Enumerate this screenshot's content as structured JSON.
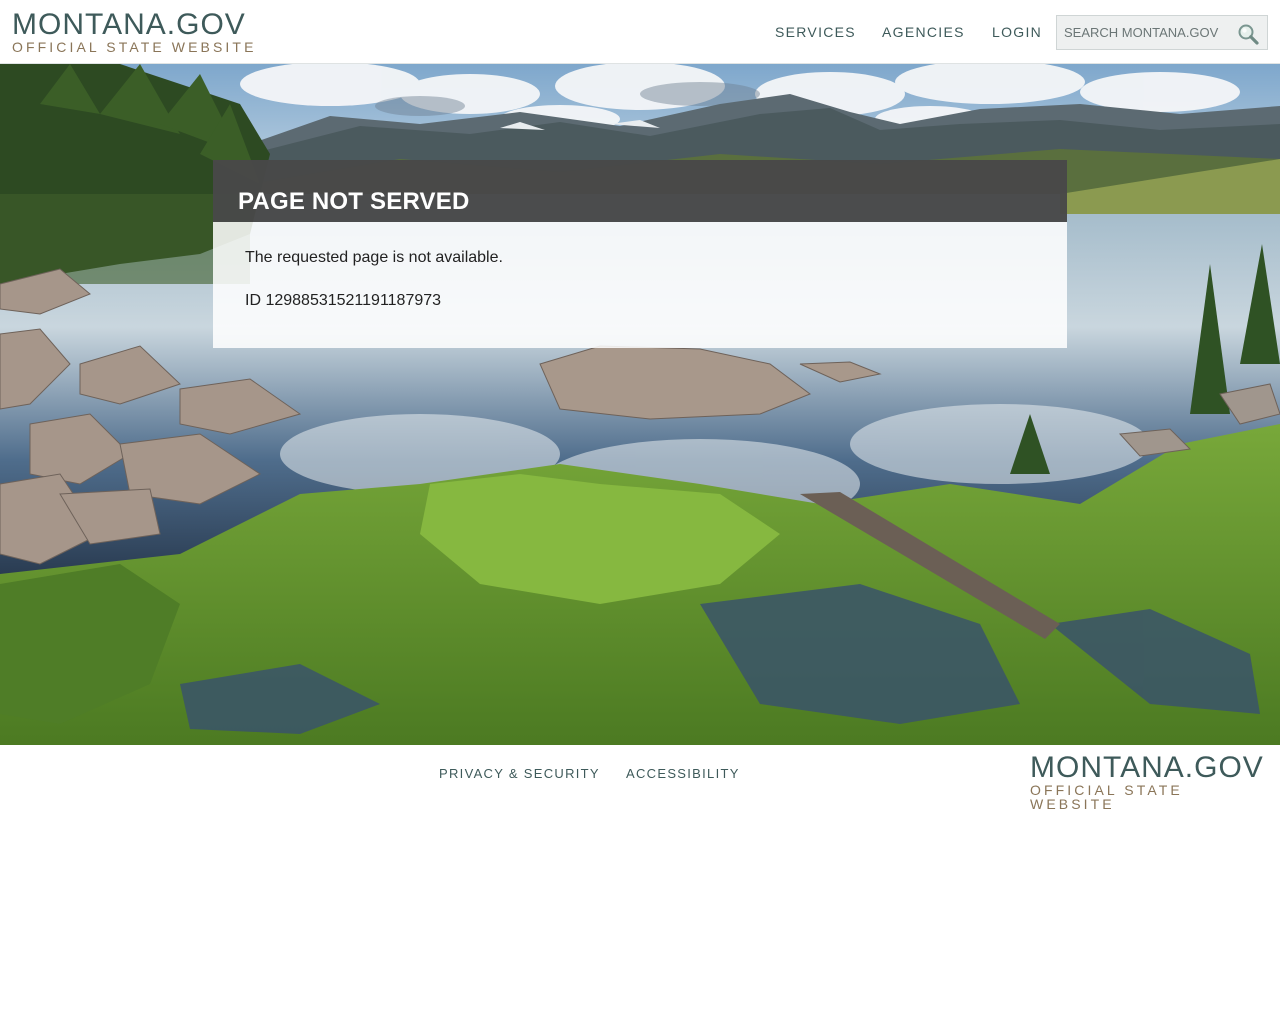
{
  "header": {
    "logo_main": "MONTANA.GOV",
    "logo_sub": "OFFICIAL STATE WEBSITE",
    "nav": {
      "services": "SERVICES",
      "agencies": "AGENCIES",
      "login": "LOGIN"
    },
    "search": {
      "placeholder": "SEARCH MONTANA.GOV",
      "icon": "search-icon"
    }
  },
  "hero": {
    "image": "mountain-lake-landscape"
  },
  "error": {
    "title": "PAGE NOT SERVED",
    "message": "The requested page is not available.",
    "id": "ID 12988531521191187973"
  },
  "footer": {
    "links": {
      "privacy": "PRIVACY & SECURITY",
      "accessibility": "ACCESSIBILITY"
    },
    "logo_main": "MONTANA.GOV",
    "logo_sub": "OFFICIAL STATE WEBSITE"
  },
  "colors": {
    "brand_teal": "#3e5a5a",
    "brand_tan": "#8a7558",
    "error_header": "#484848"
  }
}
